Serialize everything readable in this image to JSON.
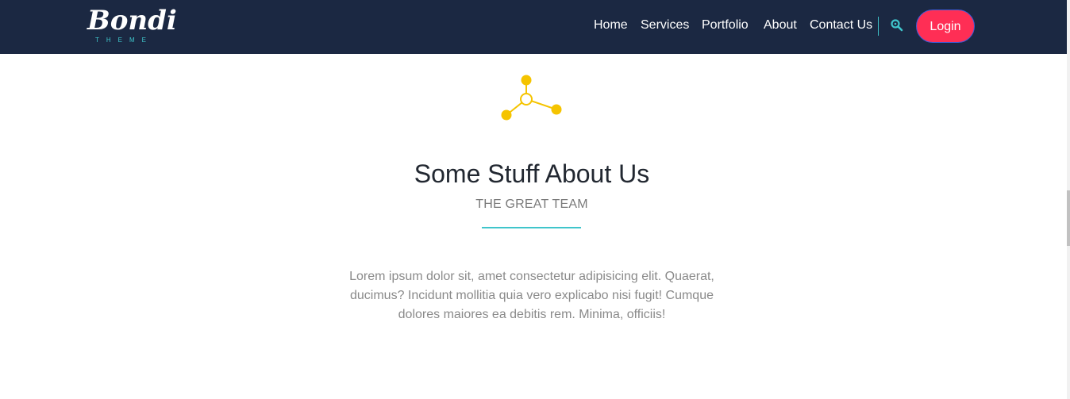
{
  "brand": {
    "name": "Bondi",
    "tagline": "THEME"
  },
  "nav": {
    "items": [
      {
        "label": "Home"
      },
      {
        "label": "Services"
      },
      {
        "label": "Portfolio"
      },
      {
        "label": "About"
      },
      {
        "label": "Contact Us"
      }
    ],
    "search_icon": "search-icon",
    "login_label": "Login"
  },
  "section": {
    "icon": "molecule-icon",
    "title": "Some Stuff About Us",
    "subtitle": "THE GREAT TEAM",
    "body": "Lorem ipsum dolor sit, amet consectetur adipisicing elit. Quaerat, ducimus? Incidunt mollitia quia vero explicabo nisi fugit! Cumque dolores maiores ea debitis rem. Minima, officiis!"
  },
  "colors": {
    "header_bg": "#1b2842",
    "accent_teal": "#3fc5cb",
    "login_bg": "#ff2e55",
    "icon_yellow": "#f5c400",
    "title_text": "#222831",
    "muted_text": "#8a8a8a"
  }
}
